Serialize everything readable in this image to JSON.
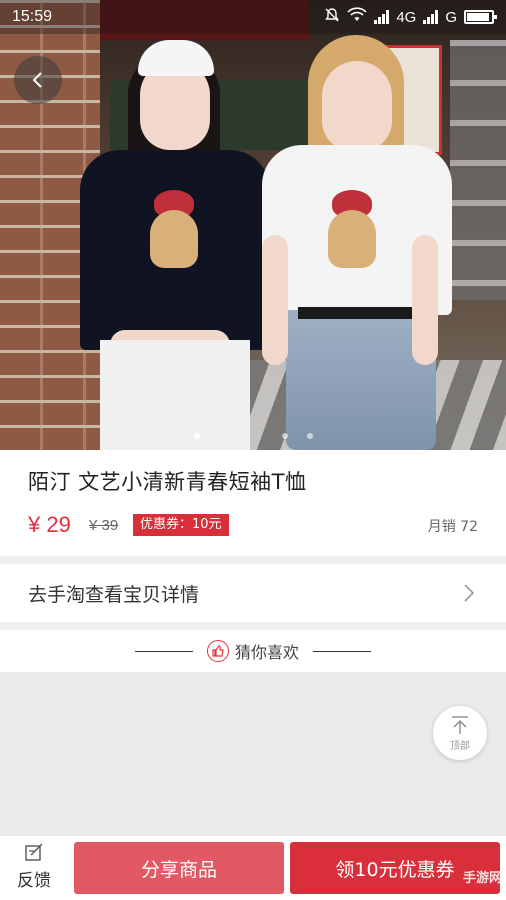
{
  "status_bar": {
    "time": "15:59",
    "network_1": "4G",
    "network_2": "G",
    "icons": [
      "mute-icon",
      "wifi-icon",
      "signal-icon",
      "battery-icon"
    ]
  },
  "hero": {
    "image": "product-photo",
    "carousel_total": 3,
    "carousel_active": 1
  },
  "product": {
    "title": "陌汀 文艺小清新青春短袖T恤",
    "price": "¥ 29",
    "original_price": "¥ 39",
    "coupon_badge": "优惠券：10元",
    "monthly_sales": "月销 72"
  },
  "detail_link": {
    "label": "去手淘查看宝贝详情"
  },
  "recommend": {
    "label": "猜你喜欢"
  },
  "top_button": {
    "label": "顶部"
  },
  "bottom_bar": {
    "feedback_label": "反馈",
    "share_label": "分享商品",
    "coupon_label": "领10元优惠券"
  },
  "watermark": "手游网",
  "colors": {
    "accent": "#d92f3b",
    "share": "#e35865",
    "text": "#222222"
  }
}
